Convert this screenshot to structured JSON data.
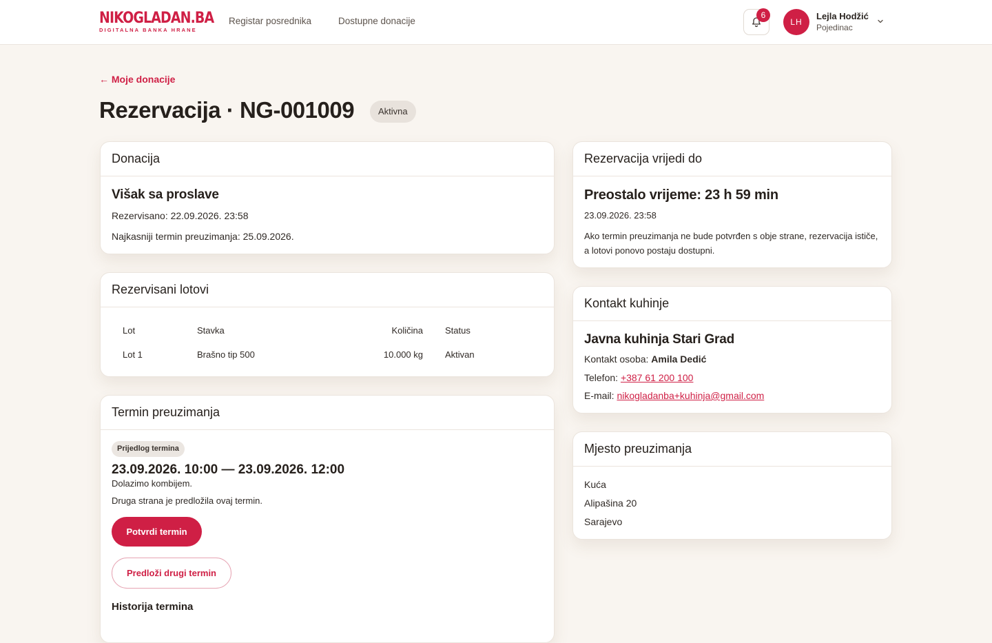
{
  "header": {
    "logo_main": "NIKOGLADAN.BA",
    "logo_sub": "DIGITALNA BANKA HRANE",
    "nav": [
      "Registar posrednika",
      "Dostupne donacije"
    ],
    "notifications_count": "6",
    "user": {
      "initials": "LH",
      "name": "Lejla Hodžić",
      "role": "Pojedinac"
    }
  },
  "page": {
    "back_link": "← Moje donacije",
    "title": "Rezervacija · NG-001009",
    "status": "Aktivna"
  },
  "donacija": {
    "heading": "Donacija",
    "title": "Višak sa proslave",
    "reserved": "Rezervisano: 22.09.2026. 23:58",
    "deadline": "Najkasniji termin preuzimanja: 25.09.2026."
  },
  "lotovi": {
    "heading": "Rezervisani lotovi",
    "columns": [
      "Lot",
      "Stavka",
      "Količina",
      "Status"
    ],
    "rows": [
      {
        "lot": "Lot 1",
        "stavka": "Brašno tip 500",
        "kolicina": "10.000 kg",
        "status": "Aktivan"
      }
    ]
  },
  "termin": {
    "heading": "Termin preuzimanja",
    "tag": "Prijedlog termina",
    "range": "23.09.2026. 10:00 — 23.09.2026. 12:00",
    "note": "Dolazimo kombijem.",
    "note2": "Druga strana je predložila ovaj termin.",
    "confirm_btn": "Potvrdi termin",
    "propose_btn": "Predloži drugi termin",
    "history_title": "Historija termina"
  },
  "vrijedi": {
    "heading": "Rezervacija vrijedi do",
    "remaining": "Preostalo vrijeme: 23 h 59 min",
    "date": "23.09.2026. 23:58",
    "note": "Ako termin preuzimanja ne bude potvrđen s obje strane, rezervacija ističe, a lotovi ponovo postaju dostupni."
  },
  "kontakt": {
    "heading": "Kontakt kuhinje",
    "name": "Javna kuhinja Stari Grad",
    "person_label": "Kontakt osoba: ",
    "person": "Amila Dedić",
    "phone_label": "Telefon: ",
    "phone": "+387 61 200 100",
    "email_label": "E-mail: ",
    "email": "nikogladanba+kuhinja@gmail.com"
  },
  "mjesto": {
    "heading": "Mjesto preuzimanja",
    "line1": "Kuća",
    "line2": "Alipašina 20",
    "line3": "Sarajevo"
  },
  "colors": {
    "accent": "#cf1f45",
    "background": "#f9f5f0"
  }
}
